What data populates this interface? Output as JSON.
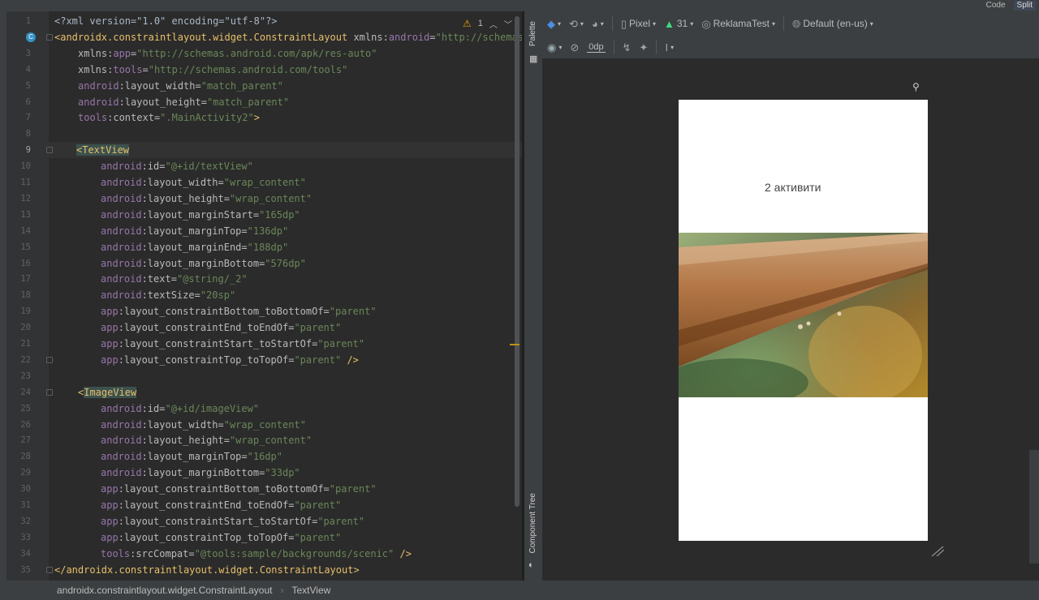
{
  "top_bar": {
    "view_modes": [
      "Code",
      "Split"
    ]
  },
  "inspection": {
    "count": "1",
    "warning_icon": "warning-icon"
  },
  "gutter": {
    "lines": [
      "1",
      "2",
      "3",
      "4",
      "5",
      "6",
      "7",
      "8",
      "9",
      "10",
      "11",
      "12",
      "13",
      "14",
      "15",
      "16",
      "17",
      "18",
      "19",
      "20",
      "21",
      "22",
      "23",
      "24",
      "25",
      "26",
      "27",
      "28",
      "29",
      "30",
      "31",
      "32",
      "33",
      "34",
      "35"
    ]
  },
  "code": {
    "line1": "<?xml version=\"1.0\" encoding=\"utf-8\"?>",
    "l2_tag": "<androidx.constraintlayout.widget.ConstraintLayout",
    "l2_attr": " xmlns:",
    "l2_ns": "android",
    "l2_eq": "=",
    "l2_val": "\"http://schemas",
    "l3_a": "xmlns:",
    "l3_ns": "app",
    "l3_v": "\"http://schemas.android.com/apk/res-auto\"",
    "l4_a": "xmlns:",
    "l4_ns": "tools",
    "l4_v": "\"http://schemas.android.com/tools\"",
    "l5_ns": "android",
    "l5_a": ":layout_width=",
    "l5_v": "\"match_parent\"",
    "l6_ns": "android",
    "l6_a": ":layout_height=",
    "l6_v": "\"match_parent\"",
    "l7_ns": "tools",
    "l7_a": ":context=",
    "l7_v": "\".MainActivity2\"",
    "l7_end": ">",
    "l9_lt": "<",
    "l9_tag": "TextView",
    "tv_attrs": [
      {
        "ns": "android",
        "a": ":id=",
        "v": "\"@+id/textView\""
      },
      {
        "ns": "android",
        "a": ":layout_width=",
        "v": "\"wrap_content\""
      },
      {
        "ns": "android",
        "a": ":layout_height=",
        "v": "\"wrap_content\""
      },
      {
        "ns": "android",
        "a": ":layout_marginStart=",
        "v": "\"165dp\""
      },
      {
        "ns": "android",
        "a": ":layout_marginTop=",
        "v": "\"136dp\""
      },
      {
        "ns": "android",
        "a": ":layout_marginEnd=",
        "v": "\"188dp\""
      },
      {
        "ns": "android",
        "a": ":layout_marginBottom=",
        "v": "\"576dp\""
      },
      {
        "ns": "android",
        "a": ":text=",
        "v": "\"@string/_2\""
      },
      {
        "ns": "android",
        "a": ":textSize=",
        "v": "\"20sp\""
      },
      {
        "ns": "app",
        "a": ":layout_constraintBottom_toBottomOf=",
        "v": "\"parent\""
      },
      {
        "ns": "app",
        "a": ":layout_constraintEnd_toEndOf=",
        "v": "\"parent\""
      },
      {
        "ns": "app",
        "a": ":layout_constraintStart_toStartOf=",
        "v": "\"parent\""
      },
      {
        "ns": "app",
        "a": ":layout_constraintTop_toTopOf=",
        "v": "\"parent\"",
        "end": " />"
      }
    ],
    "l24_lt": "<",
    "l24_tag": "ImageView",
    "iv_attrs": [
      {
        "ns": "android",
        "a": ":id=",
        "v": "\"@+id/imageView\""
      },
      {
        "ns": "android",
        "a": ":layout_width=",
        "v": "\"wrap_content\""
      },
      {
        "ns": "android",
        "a": ":layout_height=",
        "v": "\"wrap_content\""
      },
      {
        "ns": "android",
        "a": ":layout_marginTop=",
        "v": "\"16dp\""
      },
      {
        "ns": "android",
        "a": ":layout_marginBottom=",
        "v": "\"33dp\""
      },
      {
        "ns": "app",
        "a": ":layout_constraintBottom_toBottomOf=",
        "v": "\"parent\""
      },
      {
        "ns": "app",
        "a": ":layout_constraintEnd_toEndOf=",
        "v": "\"parent\""
      },
      {
        "ns": "app",
        "a": ":layout_constraintStart_toStartOf=",
        "v": "\"parent\""
      },
      {
        "ns": "app",
        "a": ":layout_constraintTop_toTopOf=",
        "v": "\"parent\""
      },
      {
        "ns": "tools",
        "a": ":srcCompat=",
        "v": "\"@tools:sample/backgrounds/scenic\"",
        "end": " />"
      }
    ],
    "l35": "</androidx.constraintlayout.widget.ConstraintLayout>"
  },
  "side_tabs": {
    "palette": "Palette",
    "component_tree": "Component Tree"
  },
  "design_toolbar": {
    "device": "Pixel",
    "api": "31",
    "theme": "ReklamaTest",
    "locale": "Default (en-us)",
    "margin": "0dp"
  },
  "preview": {
    "text": "2 активити"
  },
  "status": {
    "crumb1": "androidx.constraintlayout.widget.ConstraintLayout",
    "crumb2": "TextView"
  },
  "colors": {
    "accent": "#4a8fe0",
    "warning": "#e0a800",
    "tag": "#e8bf6a",
    "string": "#6a8759",
    "namespace": "#9876aa"
  }
}
